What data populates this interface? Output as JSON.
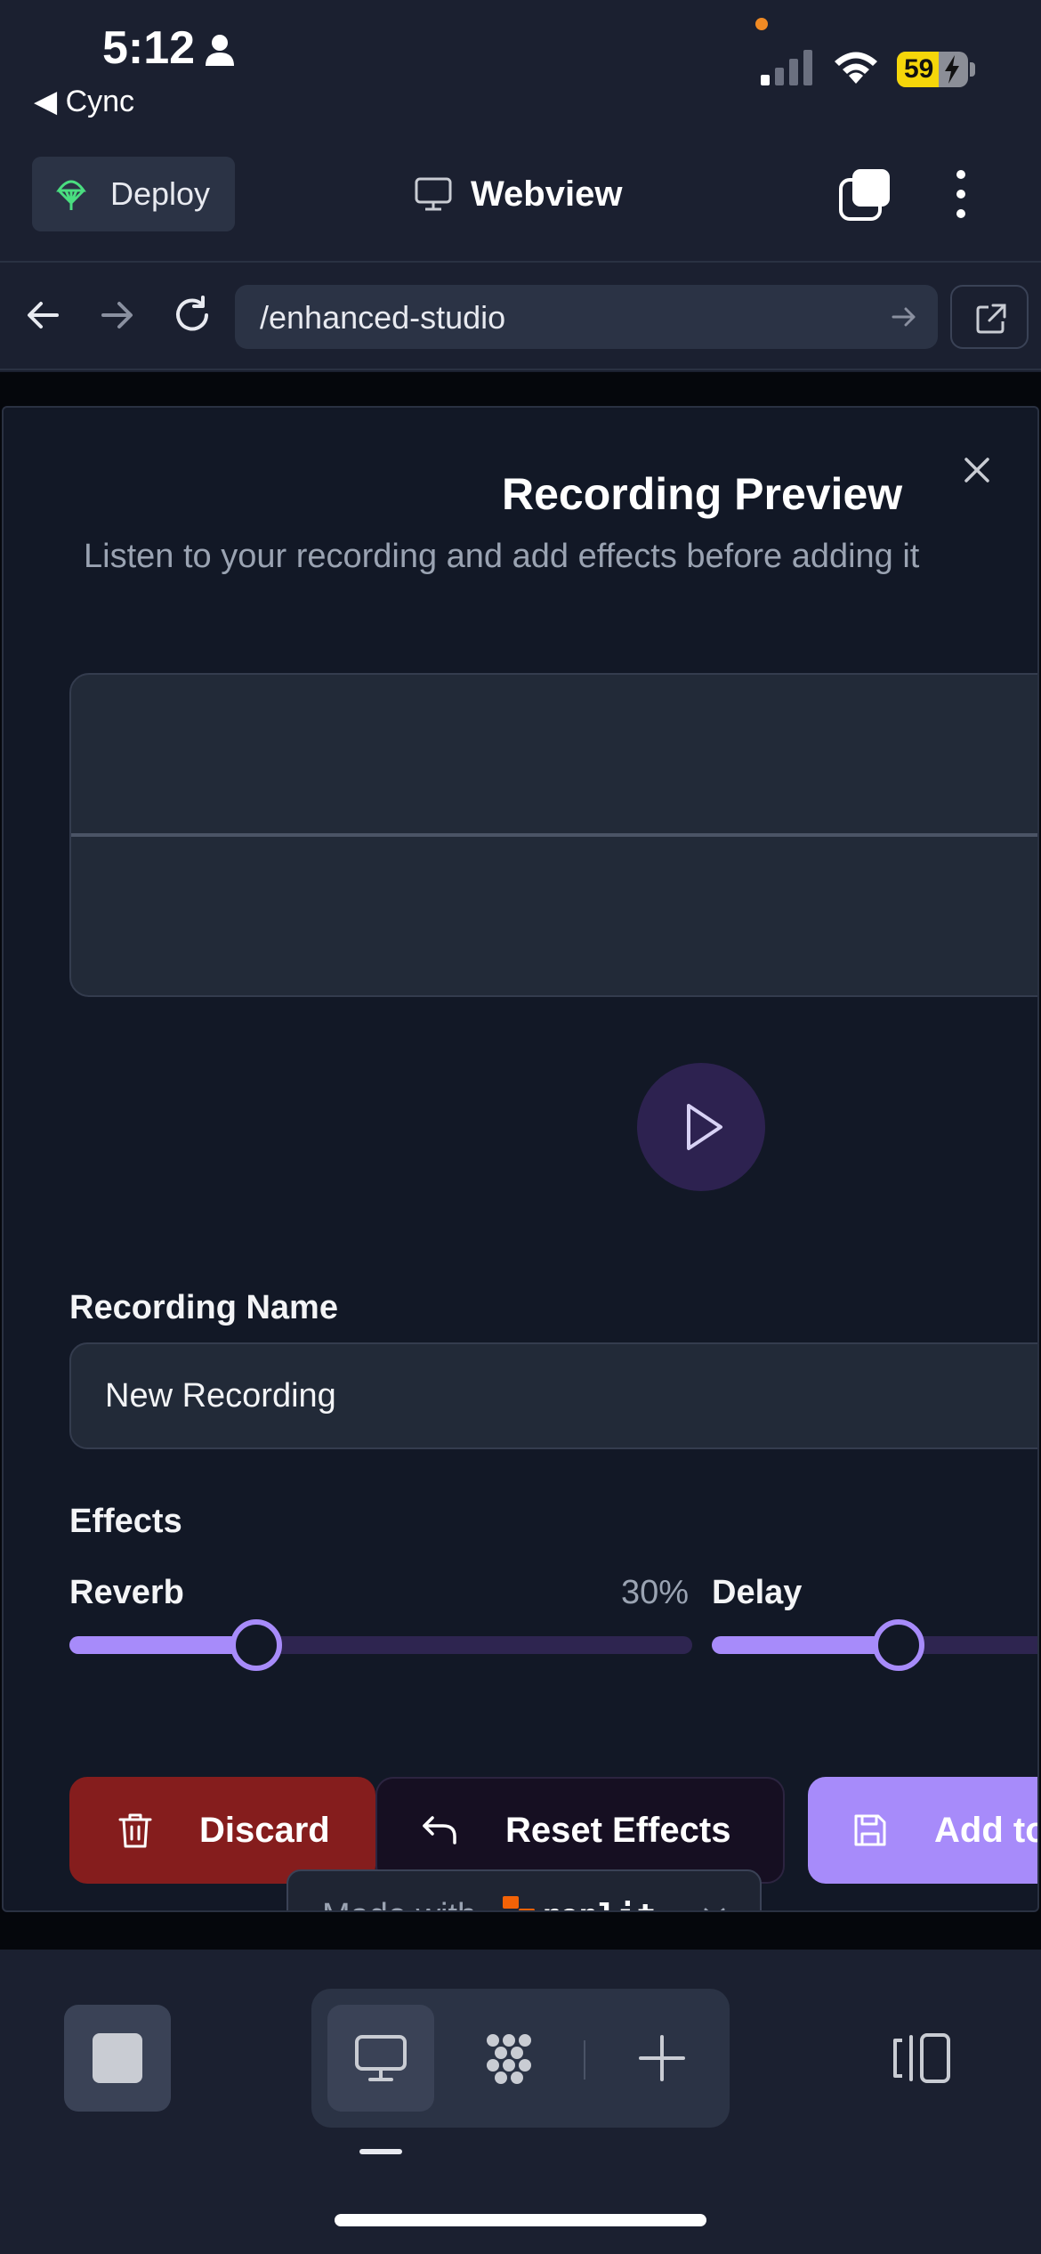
{
  "status_bar": {
    "time": "5:12",
    "back_app": "◀ Cync",
    "battery_level": "59",
    "battery_fraction": 0.59
  },
  "header": {
    "deploy_label": "Deploy",
    "title": "Webview"
  },
  "url_bar": {
    "path": "/enhanced-studio"
  },
  "modal": {
    "title": "Recording Preview",
    "subtitle": "Listen to your recording and add effects before adding it",
    "name_label": "Recording Name",
    "name_value": "New Recording",
    "effects_label": "Effects",
    "effects": [
      {
        "label": "Reverb",
        "value_text": "30%",
        "value": 0.3
      },
      {
        "label": "Delay",
        "value": 0.3
      }
    ],
    "buttons": {
      "discard": "Discard",
      "reset": "Reset Effects",
      "add": "Add to"
    }
  },
  "badge": {
    "made_with": "Made with",
    "brand": "replit"
  },
  "colors": {
    "accent": "#a78bfa",
    "danger": "#851d1d",
    "surface": "#121826",
    "chrome": "#1b2030"
  }
}
